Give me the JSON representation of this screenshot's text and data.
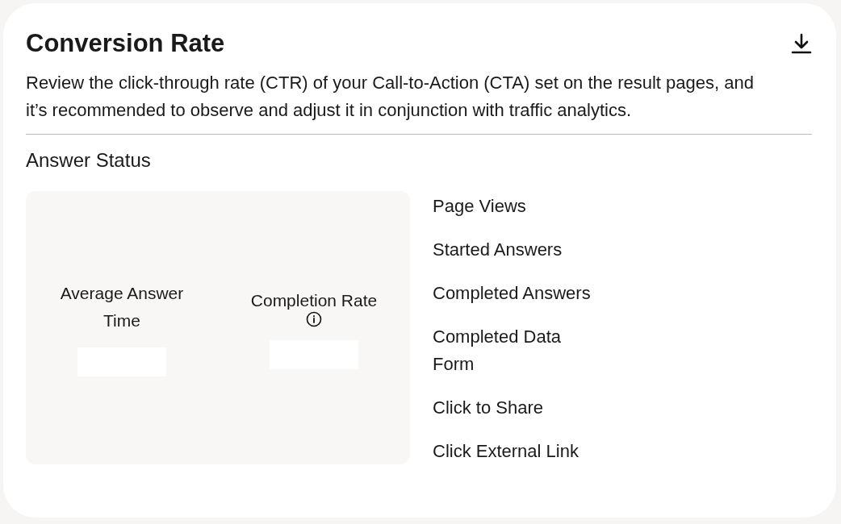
{
  "title": "Conversion Rate",
  "description": "Review the click-through rate (CTR) of your Call-to-Action (CTA) set on the result pages, and it’s recommended to observe and adjust it in conjunction with traffic analytics.",
  "section_title": "Answer Status",
  "metrics": [
    {
      "label": "Average Answer Time",
      "info_icon": false
    },
    {
      "label": "Completion Rate",
      "info_icon": true
    }
  ],
  "legend": [
    "Page Views",
    "Started Answers",
    "Completed Answers",
    "Completed Data Form",
    "Click to Share",
    "Click External Link"
  ]
}
